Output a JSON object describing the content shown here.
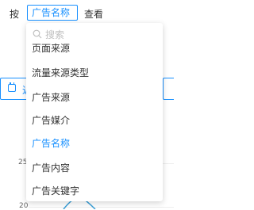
{
  "toolbar": {
    "by_label": "按",
    "dimension_value": "广告名称",
    "view_label": "查看"
  },
  "background": {
    "date_partial": "近",
    "ticks": [
      "25",
      "20"
    ]
  },
  "dropdown": {
    "search_placeholder": "搜索",
    "options": [
      {
        "label": "页面来源",
        "selected": false
      },
      {
        "label": "流量来源类型",
        "selected": false
      },
      {
        "label": "广告来源",
        "selected": false
      },
      {
        "label": "广告媒介",
        "selected": false
      },
      {
        "label": "广告名称",
        "selected": true
      },
      {
        "label": "广告内容",
        "selected": false
      },
      {
        "label": "广告关键字",
        "selected": false
      }
    ]
  },
  "colors": {
    "accent": "#1890ff",
    "text": "#333333",
    "placeholder": "#bfbfbf"
  }
}
